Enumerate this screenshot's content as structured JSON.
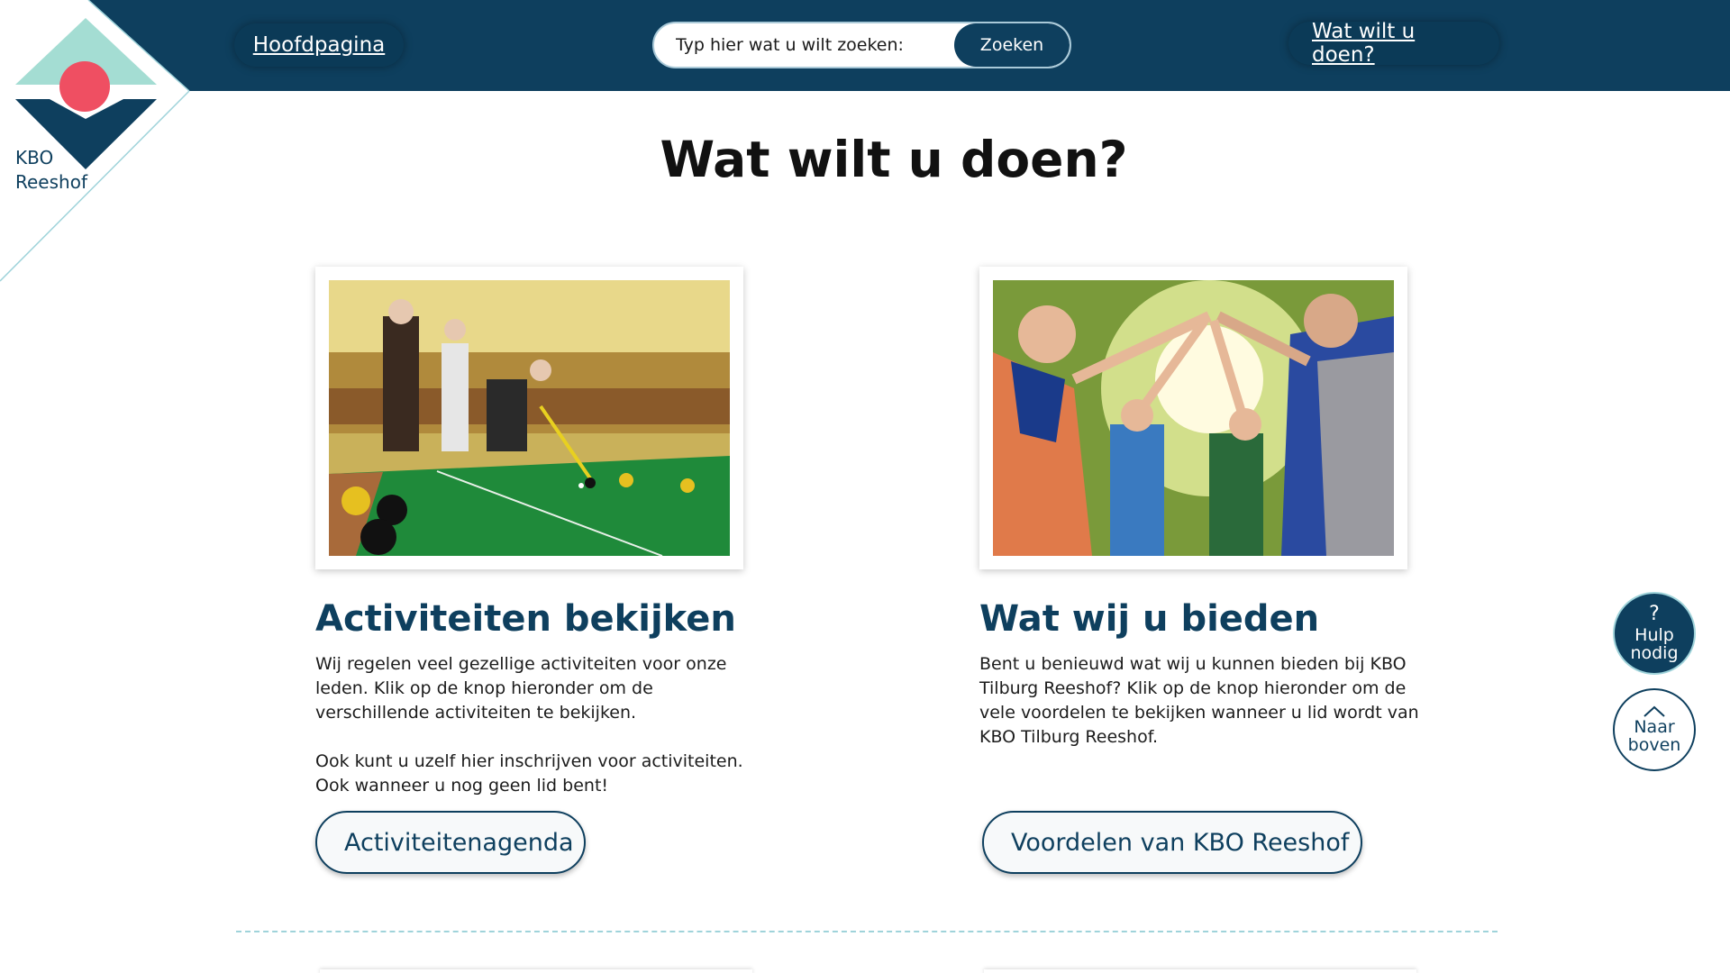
{
  "logo": {
    "line1": "KBO",
    "line2": "Reeshof"
  },
  "nav": {
    "home_label": "Hoofdpagina",
    "what_label": "Wat wilt u doen?"
  },
  "search": {
    "placeholder": "Typ hier wat u wilt zoeken:",
    "button_label": "Zoeken"
  },
  "page": {
    "title": "Wat wilt u doen?"
  },
  "cards": [
    {
      "title": "Activiteiten bekijken",
      "paragraph1": "Wij regelen veel gezellige activiteiten voor onze leden. Klik op de knop hieronder om de verschillende activiteiten te bekijken.",
      "paragraph2": "Ook kunt u uzelf hier inschrijven voor activiteiten.  Ook wanneer u nog geen lid bent!",
      "button_label": "Activiteitenagenda",
      "image_icon": "indoor-bowls-photo"
    },
    {
      "title": "Wat wij u bieden",
      "paragraph1": "Bent u benieuwd wat wij u kunnen bieden bij KBO Tilburg Reeshof? Klik op de knop hieronder om de vele voordelen te bekijken wanneer u lid wordt van KBO Tilburg Reeshof.",
      "button_label": "Voordelen van KBO Reeshof",
      "image_icon": "seniors-high-five-photo"
    }
  ],
  "floating": {
    "help_icon": "?",
    "help_label_1": "Hulp",
    "help_label_2": "nodig",
    "top_icon": "chevron-up-icon",
    "top_label_1": "Naar",
    "top_label_2": "boven"
  },
  "colors": {
    "primary": "#0e3f5e",
    "accent_teal": "#9fd3da",
    "logo_red": "#ef4f62",
    "logo_mint": "#a4ddd3"
  }
}
